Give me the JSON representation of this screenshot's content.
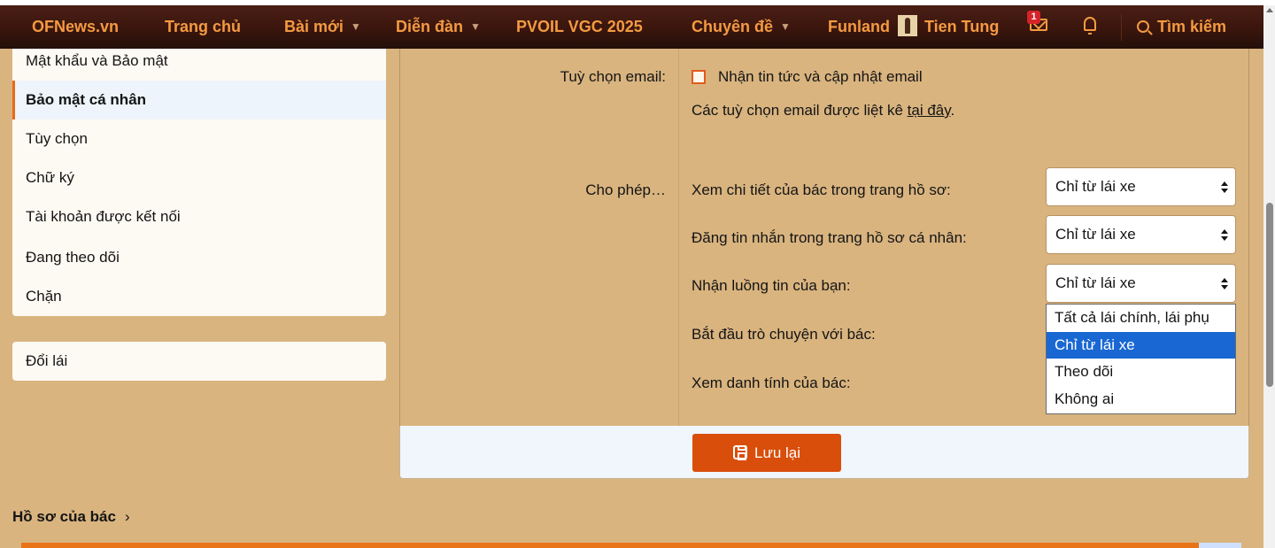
{
  "navbar": {
    "logo": "OFNews.vn",
    "items": [
      {
        "label": "Trang chủ"
      },
      {
        "label": "Bài mới"
      },
      {
        "label": "Diễn đàn"
      },
      {
        "label": "PVOIL VGC 2025"
      },
      {
        "label": "Chuyên đề"
      },
      {
        "label": "Funland"
      }
    ],
    "user_name": "Tien Tung",
    "inbox_badge": "1",
    "search_label": "Tìm kiếm"
  },
  "sidebar": {
    "items": [
      {
        "label": "Mật khẩu và Bảo mật"
      },
      {
        "label": "Bảo mật cá nhân",
        "active": true
      },
      {
        "label": "Tùy chọn"
      },
      {
        "label": "Chữ ký"
      },
      {
        "label": "Tài khoản được kết nối"
      },
      {
        "label": "Đang theo dõi"
      },
      {
        "label": "Chặn"
      }
    ],
    "second_card": {
      "label": "Đổi lái"
    },
    "profile_heading": "Hồ sơ của bác"
  },
  "form": {
    "email_label": "Tuỳ chọn email:",
    "email_checkbox_label": "Nhận tin tức và cập nhật email",
    "email_checked": false,
    "email_note_prefix": "Các tuỳ chọn email được liệt kê ",
    "email_note_link": "tại đây",
    "email_note_suffix": ".",
    "allow_label": "Cho phép…",
    "privacy_rows": [
      {
        "label": "Xem chi tiết của bác trong trang hồ sơ:",
        "value": "Chỉ từ lái xe"
      },
      {
        "label": "Đăng tin nhắn trong trang hồ sơ cá nhân:",
        "value": "Chỉ từ lái xe"
      },
      {
        "label": "Nhận luồng tin của bạn:",
        "value": "Chỉ từ lái xe"
      },
      {
        "label": "Bắt đầu trò chuyện với bác:"
      },
      {
        "label": "Xem danh tính của bác:"
      }
    ],
    "dropdown_options": [
      "Tất cả lái chính, lái phụ",
      "Chỉ từ lái xe",
      "Theo dõi",
      "Không ai"
    ],
    "dropdown_selected": "Chỉ từ lái xe",
    "save_label": "Lưu lại"
  },
  "colors": {
    "page_bg": "#d9b47f",
    "nav_bg": "#3a150d",
    "nav_text": "#f49a41",
    "accent": "#d94e0b",
    "selected_option": "#1967d2"
  }
}
